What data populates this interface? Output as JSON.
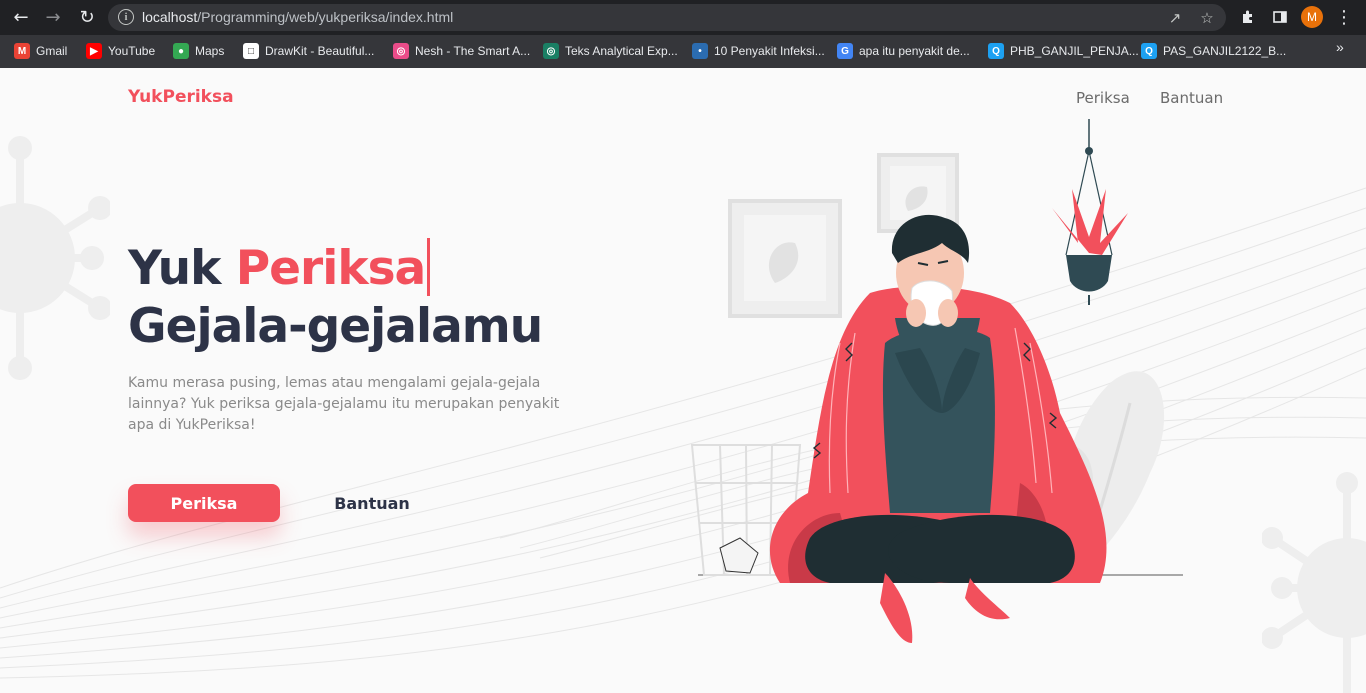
{
  "browser": {
    "url_host": "localhost",
    "url_path": "/Programming/web/yukperiksa/index.html",
    "profile_initial": "M",
    "bookmarks": [
      {
        "label": "Gmail",
        "icon": "gmail-icon",
        "color": "#ea4335"
      },
      {
        "label": "YouTube",
        "icon": "youtube-icon",
        "color": "#ff0000"
      },
      {
        "label": "Maps",
        "icon": "maps-icon",
        "color": "#34a853"
      },
      {
        "label": "DrawKit - Beautiful...",
        "icon": "drawkit-icon",
        "color": "#ffffff"
      },
      {
        "label": "Nesh - The Smart A...",
        "icon": "dribbble-icon",
        "color": "#ea4c89"
      },
      {
        "label": "Teks Analytical Exp...",
        "icon": "globe-icon",
        "color": "#1a7f64"
      },
      {
        "label": "10 Penyakit Infeksi...",
        "icon": "site-icon",
        "color": "#2b6cb0"
      },
      {
        "label": "apa itu penyakit de...",
        "icon": "google-icon",
        "color": "#4285f4"
      },
      {
        "label": "PHB_GANJIL_PENJA...",
        "icon": "quizizz-icon",
        "color": "#1da1f2"
      },
      {
        "label": "PAS_GANJIL2122_B...",
        "icon": "quizizz-icon",
        "color": "#1da1f2"
      }
    ],
    "more_label": "»"
  },
  "page": {
    "logo": "YukPeriksa",
    "nav": {
      "periksa": "Periksa",
      "bantuan": "Bantuan"
    },
    "hero": {
      "title_plain": "Yuk ",
      "title_accent": "Periksa",
      "title_line2": "Gejala-gejalamu",
      "description": "Kamu merasa pusing, lemas atau mengalami gejala-gejala lainnya? Yuk periksa gejala-gejalamu itu merupakan penyakit apa di YukPeriksa!",
      "primary_button": "Periksa",
      "secondary_button": "Bantuan"
    },
    "colors": {
      "accent": "#f2505c",
      "dark": "#2d3347",
      "muted": "#8a8a8a"
    }
  }
}
